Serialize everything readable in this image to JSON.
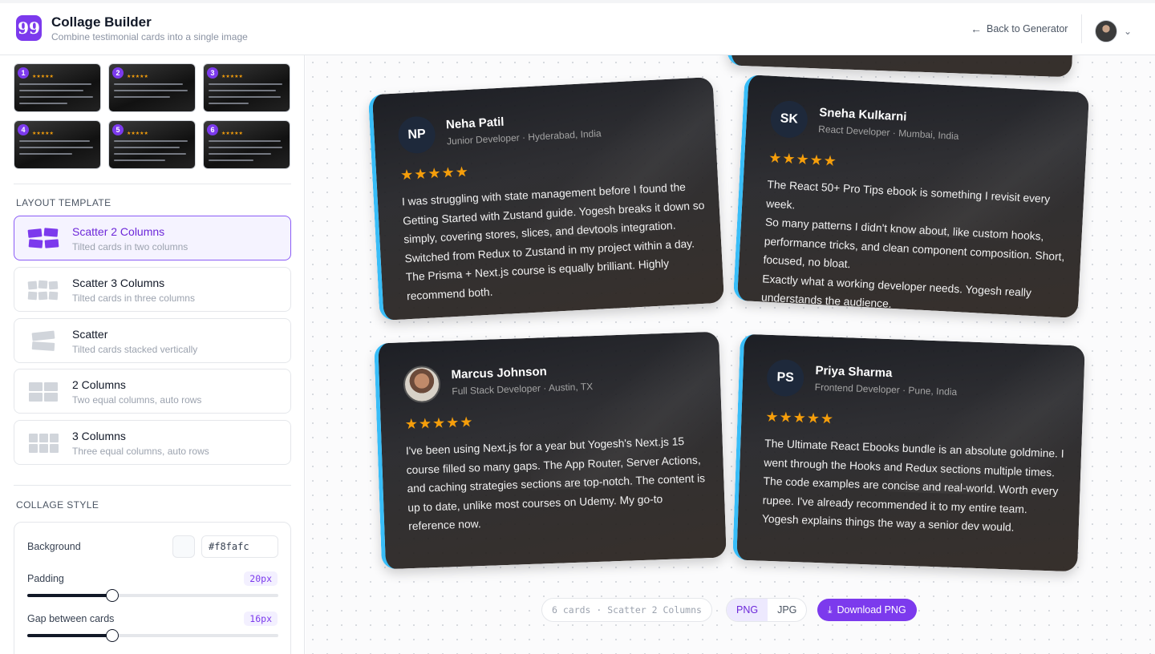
{
  "app": {
    "logo_glyph": "99",
    "title": "Collage Builder",
    "subtitle": "Combine testimonial cards into a single image"
  },
  "header": {
    "back_label": "Back to Generator"
  },
  "thumbs": [
    "1",
    "2",
    "3",
    "4",
    "5",
    "6"
  ],
  "layout": {
    "section_label": "LAYOUT TEMPLATE",
    "templates": [
      {
        "name": "Scatter 2 Columns",
        "desc": "Tilted cards in two columns",
        "active": true
      },
      {
        "name": "Scatter 3 Columns",
        "desc": "Tilted cards in three columns"
      },
      {
        "name": "Scatter",
        "desc": "Tilted cards stacked vertically"
      },
      {
        "name": "2 Columns",
        "desc": "Two equal columns, auto rows"
      },
      {
        "name": "3 Columns",
        "desc": "Three equal columns, auto rows"
      }
    ]
  },
  "style": {
    "section_label": "COLLAGE STYLE",
    "background_label": "Background",
    "background_value": "#f8fafc",
    "padding_label": "Padding",
    "padding_value": "20px",
    "padding_level": 0.34,
    "gap_label": "Gap between cards",
    "gap_value": "16px",
    "gap_level": 0.34
  },
  "cards": [
    {
      "initials": "NP",
      "name": "Neha Patil",
      "role": "Junior Developer · Hyderabad, India",
      "stars": "★★★★★",
      "text": "I was struggling with state management before I found the Getting Started with Zustand guide. Yogesh breaks it down so simply, covering stores, slices, and devtools integration. Switched from Redux to Zustand in my project within a day. The Prisma + Next.js course is equally brilliant. Highly recommend both."
    },
    {
      "initials": "SK",
      "name": "Sneha Kulkarni",
      "role": "React Developer · Mumbai, India",
      "stars": "★★★★★",
      "text": "The React 50+ Pro Tips ebook is something I revisit every week.\nSo many patterns I didn't know about, like custom hooks, performance tricks, and clean component composition. Short, focused, no bloat.\nExactly what a working developer needs. Yogesh really understands the audience."
    },
    {
      "initials": "",
      "name": "Marcus Johnson",
      "role": "Full Stack Developer · Austin, TX",
      "stars": "★★★★★",
      "text": "I've been using Next.js for a year but Yogesh's Next.js 15 course filled so many gaps. The App Router, Server Actions, and caching strategies sections are top-notch. The content is up to date, unlike most courses on Udemy. My go-to reference now."
    },
    {
      "initials": "PS",
      "name": "Priya Sharma",
      "role": "Frontend Developer · Pune, India",
      "stars": "★★★★★",
      "text": "The Ultimate React Ebooks bundle is an absolute goldmine. I went through the Hooks and Redux sections multiple times. The code examples are concise and real-world. Worth every rupee. I've already recommended it to my entire team. Yogesh explains things the way a senior dev would."
    }
  ],
  "footer": {
    "status": "6 cards · Scatter 2 Columns",
    "format_png": "PNG",
    "format_jpg": "JPG",
    "download_label": "Download PNG"
  },
  "colors": {
    "accent": "#7c3aed",
    "card_border": "#38bdf8",
    "star": "#f59e0b"
  }
}
